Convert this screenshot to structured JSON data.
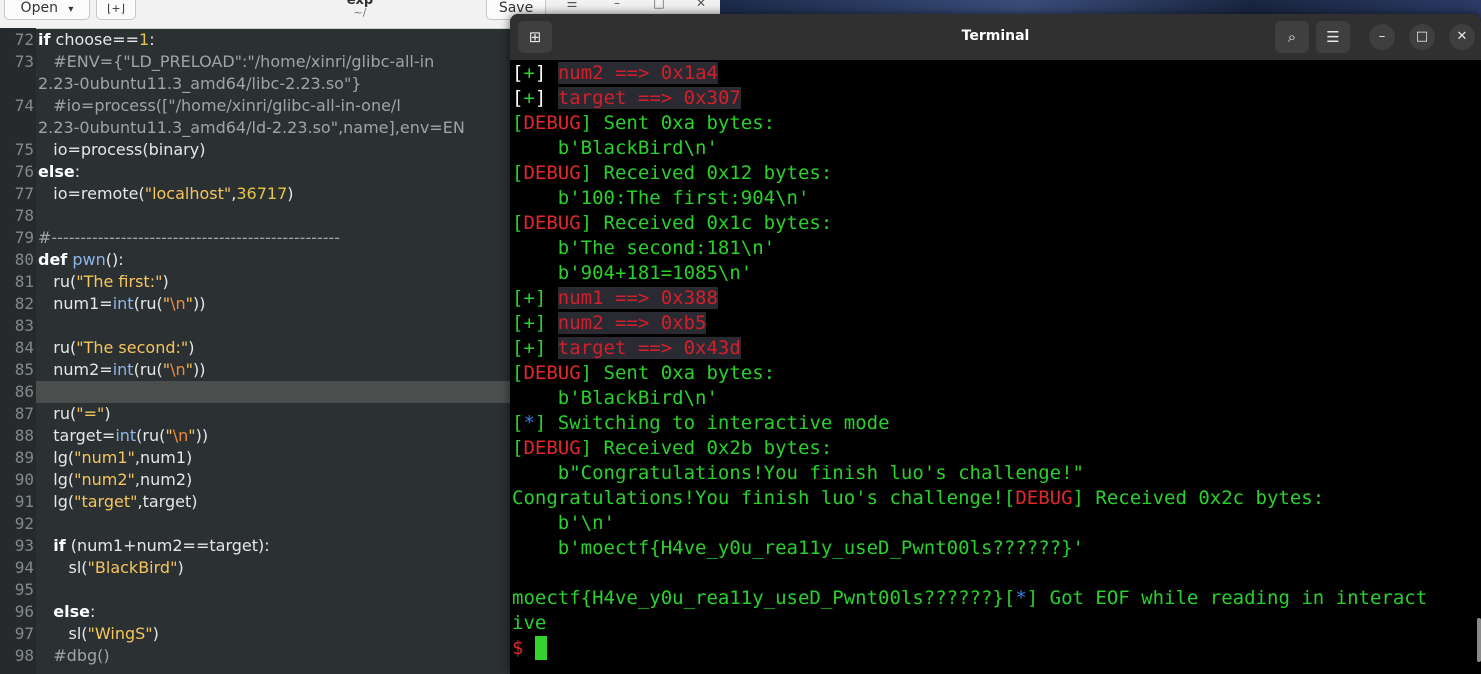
{
  "editor": {
    "open_button": "Open",
    "new_tab_icon": "new-document-icon",
    "title": "exp",
    "subtitle": "~/",
    "save_button": "Save",
    "lines": [
      {
        "n": "72",
        "html": "<span class='kw'>if</span> choose==<span class='num'>1</span>:"
      },
      {
        "n": "73",
        "html": "   <span class='cm'>#ENV={\"LD_PRELOAD\":\"/home/xinri/glibc-all-in</span>"
      },
      {
        "n": "",
        "html": "<span class='cm'>2.23-0ubuntu11.3_amd64/libc-2.23.so\"}</span>"
      },
      {
        "n": "74",
        "html": "   <span class='cm'>#io=process([\"/home/xinri/glibc-all-in-one/l</span>"
      },
      {
        "n": "",
        "html": "<span class='cm'>2.23-0ubuntu11.3_amd64/ld-2.23.so\",name],env=EN</span>"
      },
      {
        "n": "75",
        "html": "   io=process(binary)"
      },
      {
        "n": "76",
        "html": "<span class='kw'>else</span>:"
      },
      {
        "n": "77",
        "html": "   io=remote(<span class='str'>\"localhost\"</span>,<span class='num'>36717</span>)"
      },
      {
        "n": "78",
        "html": ""
      },
      {
        "n": "79",
        "html": "<span class='cm'>#--------------------------------------------------</span>"
      },
      {
        "n": "80",
        "html": "<span class='kw'>def</span> <span class='fn'>pwn</span>():"
      },
      {
        "n": "81",
        "html": "   ru(<span class='str'>\"The first:\"</span>)"
      },
      {
        "n": "82",
        "html": "   num1=<span class='fn'>int</span>(ru(<span class='str'>\"</span><span class='esc'>\\n</span><span class='str'>\"</span>))"
      },
      {
        "n": "83",
        "html": ""
      },
      {
        "n": "84",
        "html": "   ru(<span class='str'>\"The second:\"</span>)"
      },
      {
        "n": "85",
        "html": "   num2=<span class='fn'>int</span>(ru(<span class='str'>\"</span><span class='esc'>\\n</span><span class='str'>\"</span>))"
      },
      {
        "n": "86",
        "html": ""
      },
      {
        "n": "87",
        "html": "   ru(<span class='str'>\"=\"</span>)"
      },
      {
        "n": "88",
        "html": "   target=<span class='fn'>int</span>(ru(<span class='str'>\"</span><span class='esc'>\\n</span><span class='str'>\"</span>))"
      },
      {
        "n": "89",
        "html": "   lg(<span class='str'>\"num1\"</span>,num1)"
      },
      {
        "n": "90",
        "html": "   lg(<span class='str'>\"num2\"</span>,num2)"
      },
      {
        "n": "91",
        "html": "   lg(<span class='str'>\"target\"</span>,target)"
      },
      {
        "n": "92",
        "html": ""
      },
      {
        "n": "93",
        "html": "   <span class='kw'>if</span> (num1+num2==target):"
      },
      {
        "n": "94",
        "html": "      sl(<span class='str'>\"BlackBird\"</span>)"
      },
      {
        "n": "95",
        "html": ""
      },
      {
        "n": "96",
        "html": "   <span class='kw'>else</span>:"
      },
      {
        "n": "97",
        "html": "      sl(<span class='str'>\"WingS\"</span>)"
      },
      {
        "n": "98",
        "html": "   <span class='cm'>#dbg()</span>"
      }
    ]
  },
  "terminal": {
    "title": "Terminal",
    "new_tab_icon": "new-tab-icon",
    "search_icon": "search-icon",
    "menu_icon": "hamburger-menu-icon",
    "minimize_icon": "minimize-icon",
    "maximize_icon": "maximize-icon",
    "close_icon": "close-icon",
    "lines": [
      "<span class='wht'>[</span>+<span class='wht'>]</span> <span class='hl'>num2 ==> 0x1a4</span>",
      "<span class='wht'>[</span>+<span class='wht'>]</span> <span class='hl'>target ==> 0x307</span>",
      "[<span class='red'>DEBUG</span>] Sent 0xa bytes:",
      "    b'BlackBird\\n'",
      "[<span class='red'>DEBUG</span>] Received 0x12 bytes:",
      "    b'100:The first:904\\n'",
      "[<span class='red'>DEBUG</span>] Received 0x1c bytes:",
      "    b'The second:181\\n'",
      "    b'904+181=1085\\n'",
      "[+] <span class='hl'>num1 ==> 0x388</span>",
      "[+] <span class='hl'>num2 ==> 0xb5</span>",
      "[+] <span class='hl'>target ==> 0x43d</span>",
      "[<span class='red'>DEBUG</span>] Sent 0xa bytes:",
      "    b'BlackBird\\n'",
      "[<span class='blu'>*</span>] Switching to interactive mode",
      "[<span class='red'>DEBUG</span>] Received 0x2b bytes:",
      "    b\"Congratulations!You finish luo's challenge!\"",
      "Congratulations!You finish luo's challenge![<span class='red'>DEBUG</span>] Received 0x2c bytes:",
      "    b'\\n'",
      "    b'moectf{H4ve_y0u_rea11y_useD_Pwnt00ls??????}'",
      "",
      "moectf{H4ve_y0u_rea11y_useD_Pwnt00ls??????}[<span class='blu'>*</span>] Got EOF while reading in interact",
      "ive"
    ],
    "prompt": "$"
  }
}
